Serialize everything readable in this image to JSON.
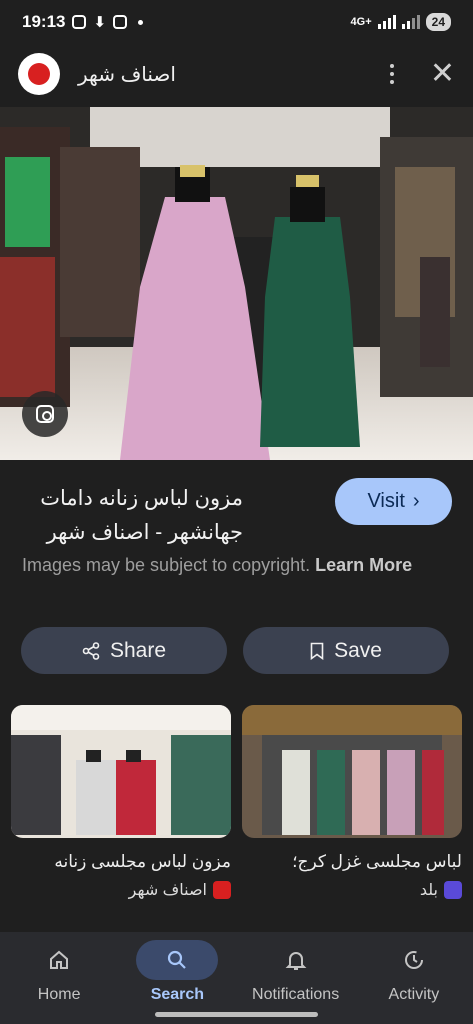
{
  "status": {
    "time": "19:13",
    "network": "4G+",
    "battery": "24"
  },
  "header": {
    "title": "اصناف شهر"
  },
  "result": {
    "title": "مزون لباس زنانه دامات جهانشهر - اصناف شهر",
    "visit_label": "Visit",
    "copyright_text": "Images may be subject to copyright.",
    "learn_more": "Learn More"
  },
  "actions": {
    "share": "Share",
    "save": "Save"
  },
  "related": [
    {
      "title": "مزون لباس مجلسی زنانه",
      "source": "اصناف شهر"
    },
    {
      "title": "لباس مجلسی غزل کرج؛",
      "source": "بلد"
    }
  ],
  "nav": {
    "home": "Home",
    "search": "Search",
    "notifications": "Notifications",
    "activity": "Activity"
  },
  "colors": {
    "accent": "#a8c7fa",
    "background": "#1f1f1f"
  }
}
